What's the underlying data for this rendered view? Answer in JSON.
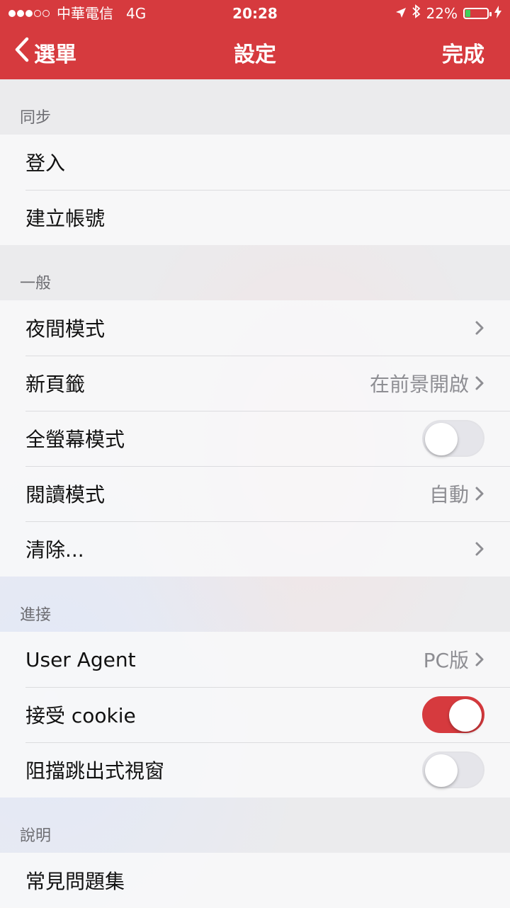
{
  "status_bar": {
    "carrier": "中華電信",
    "network": "4G",
    "time": "20:28",
    "battery": "22%",
    "battery_level": 0.22,
    "icons": [
      "location-arrow-icon",
      "bluetooth-icon",
      "battery-icon",
      "charging-bolt-icon"
    ]
  },
  "nav": {
    "back_label": "選單",
    "title": "設定",
    "done_label": "完成"
  },
  "colors": {
    "accent": "#d63a3e",
    "toggle_off": "#e5e5ea",
    "detail_text": "#8e8e93",
    "section_header_text": "#6d6d72"
  },
  "sections": {
    "sync": {
      "header": "同步",
      "rows": [
        {
          "label": "登入"
        },
        {
          "label": "建立帳號"
        }
      ]
    },
    "general": {
      "header": "一般",
      "rows": [
        {
          "label": "夜間模式",
          "accessory": "chevron-right-icon"
        },
        {
          "label": "新頁籤",
          "detail": "在前景開啟",
          "accessory": "chevron-right-icon"
        },
        {
          "label": "全螢幕模式",
          "toggle": false
        },
        {
          "label": "閱讀模式",
          "detail": "自動",
          "accessory": "chevron-right-icon"
        },
        {
          "label": "清除...",
          "accessory": "chevron-right-icon"
        }
      ]
    },
    "advanced": {
      "header": "進接",
      "rows": [
        {
          "label": "User Agent",
          "detail": "PC版",
          "accessory": "chevron-right-icon"
        },
        {
          "label": "接受 cookie",
          "toggle": true
        },
        {
          "label": "阻擋跳出式視窗",
          "toggle": false
        }
      ]
    },
    "help": {
      "header": "說明",
      "rows": [
        {
          "label": "常見問題集"
        }
      ]
    }
  }
}
